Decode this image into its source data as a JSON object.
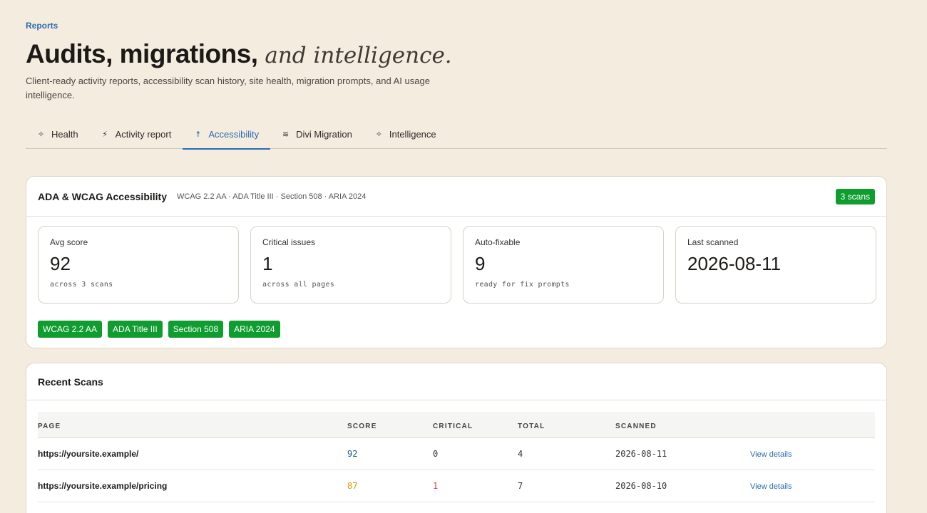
{
  "header": {
    "eyebrow": "Reports",
    "title_main": "Audits, migrations,",
    "title_italic": "and intelligence.",
    "subtitle": "Client-ready activity reports, accessibility scan history, site health, migration prompts, and AI usage intelligence."
  },
  "tabs": [
    {
      "label": "Health",
      "icon": "sparkle-icon",
      "glyph": "✧"
    },
    {
      "label": "Activity report",
      "icon": "bolt-icon",
      "glyph": "⚡"
    },
    {
      "label": "Accessibility",
      "icon": "accessibility-icon",
      "glyph": "☨",
      "active": true
    },
    {
      "label": "Divi Migration",
      "icon": "layers-icon",
      "glyph": "≋"
    },
    {
      "label": "Intelligence",
      "icon": "sparkle-icon",
      "glyph": "✧"
    }
  ],
  "accessibility": {
    "title": "ADA & WCAG Accessibility",
    "standards_line": "WCAG 2.2 AA · ADA Title III · Section 508 · ARIA 2024",
    "scans_badge": "3 scans",
    "stats": [
      {
        "label": "Avg score",
        "value": "92",
        "note": "across 3 scans"
      },
      {
        "label": "Critical issues",
        "value": "1",
        "note": "across all pages"
      },
      {
        "label": "Auto-fixable",
        "value": "9",
        "note": "ready for fix prompts"
      },
      {
        "label": "Last scanned",
        "value": "2026-08-11",
        "note": ""
      }
    ],
    "tags": [
      "WCAG 2.2 AA",
      "ADA Title III",
      "Section 508",
      "ARIA 2024"
    ]
  },
  "recent_scans": {
    "title": "Recent Scans",
    "columns": [
      "PAGE",
      "SCORE",
      "CRITICAL",
      "TOTAL",
      "SCANNED"
    ],
    "rows": [
      {
        "page": "https://yoursite.example/",
        "score": "92",
        "critical": "0",
        "total": "4",
        "scanned": "2026-08-11",
        "action": "View details"
      },
      {
        "page": "https://yoursite.example/pricing",
        "score": "87",
        "critical": "1",
        "total": "7",
        "scanned": "2026-08-10",
        "action": "View details"
      }
    ]
  },
  "colors": {
    "background": "#f5ece0",
    "accent": "#2b6cb0",
    "badge_green": "#0f9d30",
    "score_good": "#1a5f7a",
    "score_warn": "#d99a00",
    "critical_red": "#e53e3e"
  }
}
